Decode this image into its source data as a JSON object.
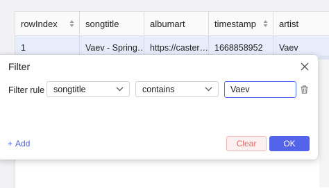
{
  "table": {
    "columns": [
      "rowIndex",
      "songtitle",
      "albumart",
      "timestamp",
      "artist"
    ],
    "rows": [
      [
        "1",
        "Vaev - Spring…",
        "https://caster…",
        "1668858952",
        "Vaev"
      ]
    ]
  },
  "dialog": {
    "title": "Filter",
    "rule_label": "Filter rule",
    "field_select": "songtitle",
    "operator_select": "contains",
    "value_input": "Vaev",
    "add_label": "Add",
    "clear_label": "Clear",
    "ok_label": "OK"
  },
  "colors": {
    "accent": "#5464ea",
    "clear_text": "#e06565",
    "row_highlight": "#e8edfb"
  },
  "icons": {
    "sort": "sort-icon",
    "close": "close-icon",
    "chevron": "chevron-down-icon",
    "trash": "trash-icon",
    "plus": "plus-icon"
  }
}
